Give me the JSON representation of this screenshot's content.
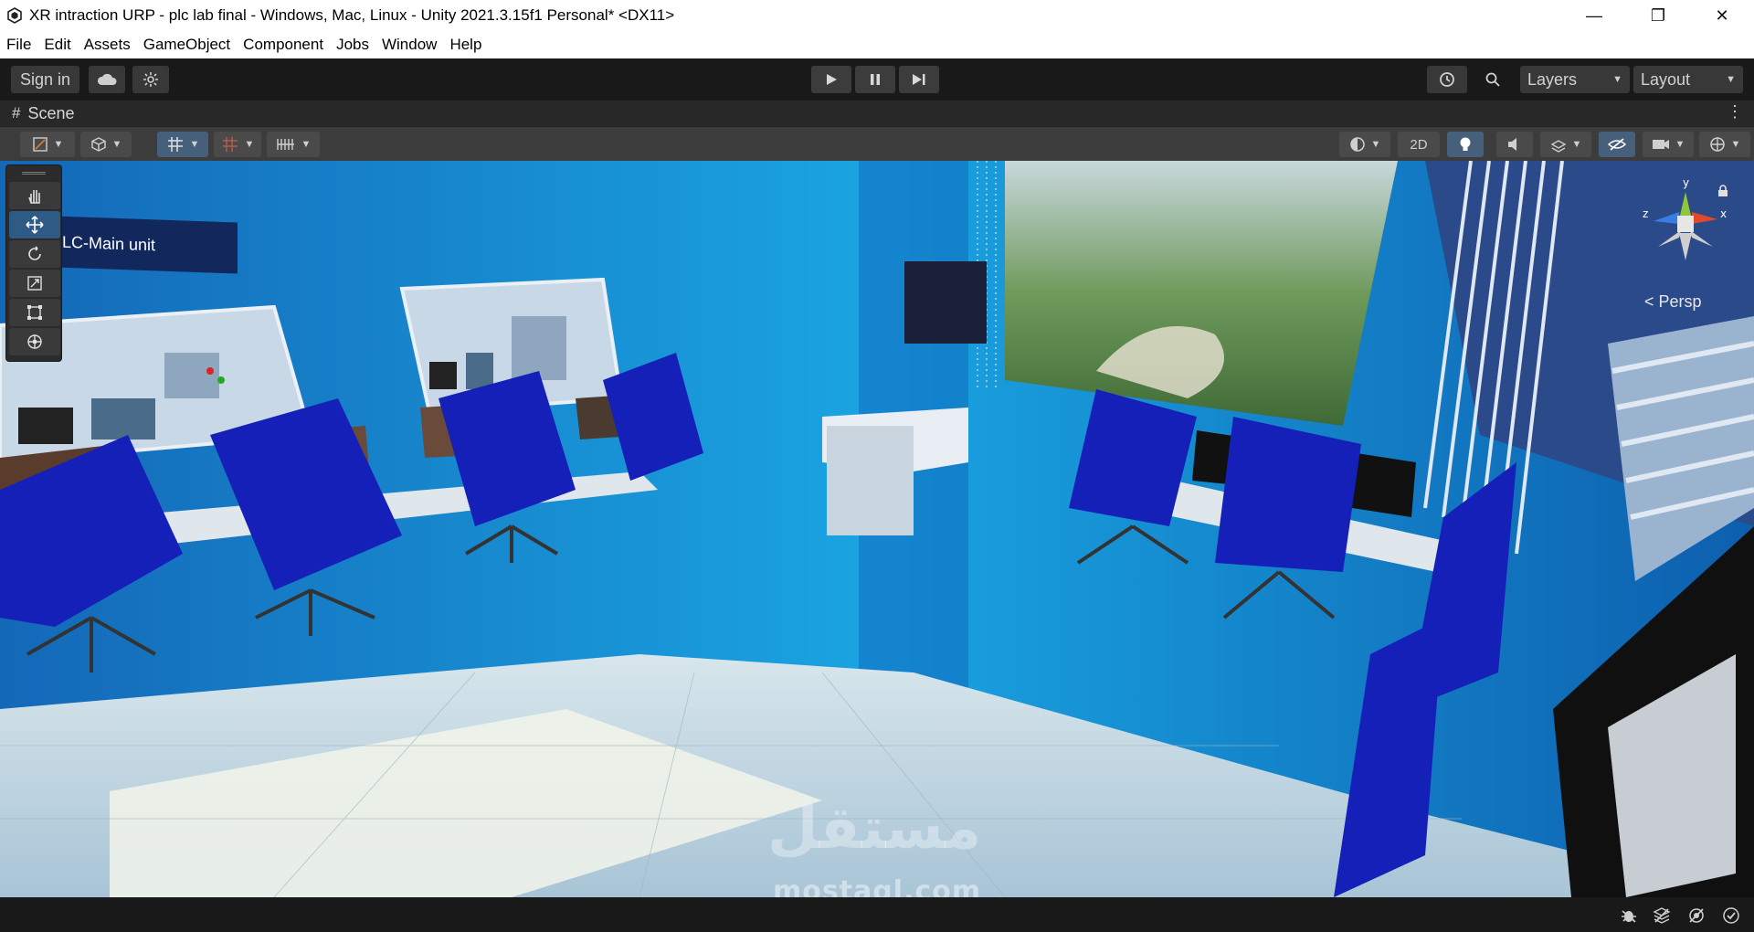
{
  "window": {
    "title": "XR intraction URP - plc lab final - Windows, Mac, Linux - Unity 2021.3.15f1 Personal* <DX11>",
    "minimize": "—",
    "restore": "❐",
    "close": "✕"
  },
  "menu": [
    "File",
    "Edit",
    "Assets",
    "GameObject",
    "Component",
    "Jobs",
    "Window",
    "Help"
  ],
  "toolbar": {
    "sign_in": "Sign in",
    "layers": "Layers",
    "layout": "Layout"
  },
  "scene_tab": {
    "label": "Scene",
    "mode_2d": "2D"
  },
  "scene": {
    "label_plc": "LC-Main unit",
    "persp": "< Persp",
    "gizmo_x": "x",
    "gizmo_y": "y",
    "gizmo_z": "z"
  },
  "watermark": {
    "arabic": "مستقل",
    "latin": "mostaql.com"
  },
  "colors": {
    "wall": "#1a8fd0",
    "chair": "#1420b8",
    "floor": "#cfe2ea",
    "active_tool": "#2e5a86"
  },
  "icons": {
    "hand_tool": "hand-icon",
    "move_tool": "move-icon",
    "rotate_tool": "rotate-icon",
    "scale_tool": "scale-icon",
    "rect_tool": "rect-icon",
    "transform_tool": "transform-icon"
  }
}
